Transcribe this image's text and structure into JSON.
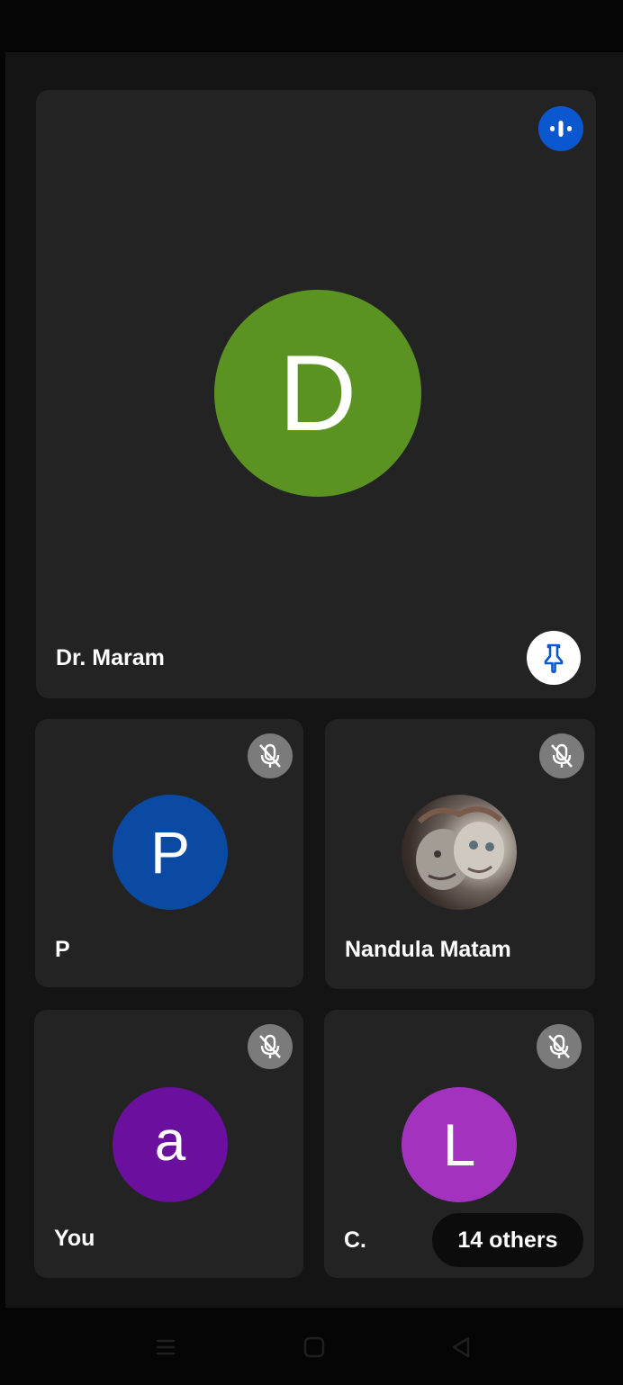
{
  "main_tile": {
    "participant_name": "Dr. Maram",
    "avatar_letter": "D",
    "avatar_color": "#5b9322",
    "speaking_indicator_icon": "audio-level-icon",
    "pin_icon": "pin-icon"
  },
  "tiles": [
    {
      "participant_name": "P",
      "avatar_letter": "P",
      "avatar_color": "#0b4aa2",
      "status_icon": "mic-off-icon"
    },
    {
      "participant_name": "Nandula Matam",
      "avatar_type": "photo",
      "status_icon": "mic-off-icon"
    },
    {
      "participant_name": "You",
      "avatar_letter": "a",
      "avatar_color": "#6a0f9e",
      "status_icon": "mic-off-icon"
    },
    {
      "participant_name": "C.",
      "avatar_letter": "L",
      "avatar_color": "#a333bf",
      "status_icon": "mic-off-icon",
      "overflow_label": "14 others"
    }
  ],
  "navigation_bar": {
    "icons": [
      "menu-icon",
      "home-icon",
      "back-icon"
    ]
  },
  "colors": {
    "tile_background": "#232323",
    "speaking_indicator": "#0b57d0",
    "muted_badge": "#7b7b7b"
  }
}
